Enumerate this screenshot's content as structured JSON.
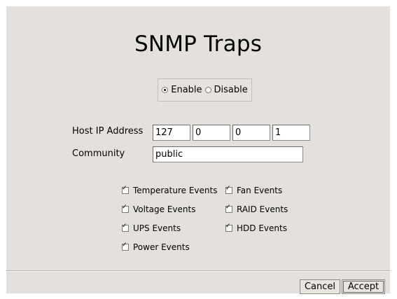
{
  "title": "SNMP Traps",
  "mode": {
    "enable_label": "Enable",
    "disable_label": "Disable",
    "selected": "enable"
  },
  "host_ip": {
    "label": "Host IP Address",
    "octets": [
      "127",
      "0",
      "0",
      "1"
    ]
  },
  "community": {
    "label": "Community",
    "value": "public"
  },
  "events": {
    "temperature": {
      "label": "Temperature Events",
      "checked": true
    },
    "fan": {
      "label": "Fan Events",
      "checked": true
    },
    "voltage": {
      "label": "Voltage Events",
      "checked": true
    },
    "raid": {
      "label": "RAID Events",
      "checked": true
    },
    "ups": {
      "label": "UPS Events",
      "checked": true
    },
    "hdd": {
      "label": "HDD Events",
      "checked": true
    },
    "power": {
      "label": "Power Events",
      "checked": true
    }
  },
  "buttons": {
    "cancel": "Cancel",
    "accept": "Accept"
  }
}
